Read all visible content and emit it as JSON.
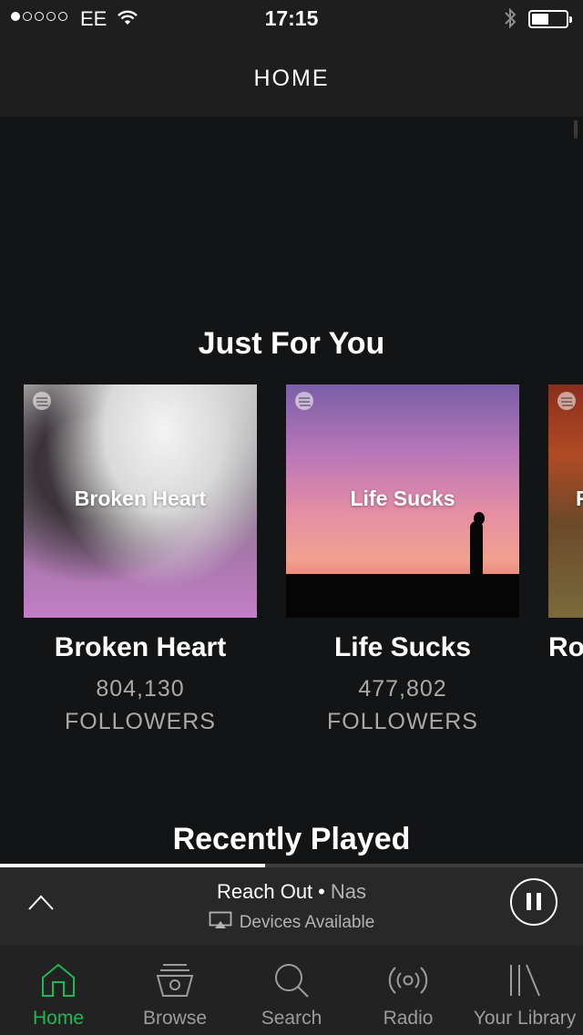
{
  "status_bar": {
    "carrier": "EE",
    "time": "17:15",
    "signal_dots": [
      true,
      false,
      false,
      false,
      false
    ]
  },
  "header": {
    "title": "HOME"
  },
  "sections": {
    "just_for_you": {
      "title": "Just For You",
      "cards": [
        {
          "cover_label": "Broken Heart",
          "title": "Broken Heart",
          "followers": "804,130",
          "followers_label": "FOLLOWERS"
        },
        {
          "cover_label": "Life Sucks",
          "title": "Life Sucks",
          "followers": "477,802",
          "followers_label": "FOLLOWERS"
        },
        {
          "cover_label": "R",
          "title": "Ro"
        }
      ]
    },
    "recently_played": {
      "title": "Recently Played"
    }
  },
  "now_playing": {
    "track": "Reach Out",
    "separator": "•",
    "artist": "Nas",
    "devices_label": "Devices Available",
    "progress": 0.455
  },
  "tabs": [
    {
      "label": "Home",
      "icon": "home-icon",
      "active": true
    },
    {
      "label": "Browse",
      "icon": "browse-icon",
      "active": false
    },
    {
      "label": "Search",
      "icon": "search-icon",
      "active": false
    },
    {
      "label": "Radio",
      "icon": "radio-icon",
      "active": false
    },
    {
      "label": "Your Library",
      "icon": "library-icon",
      "active": false
    }
  ],
  "colors": {
    "accent": "#1db954",
    "background": "#121314",
    "header": "#1e1e1f",
    "player": "#282828",
    "tabbar": "#222223"
  }
}
